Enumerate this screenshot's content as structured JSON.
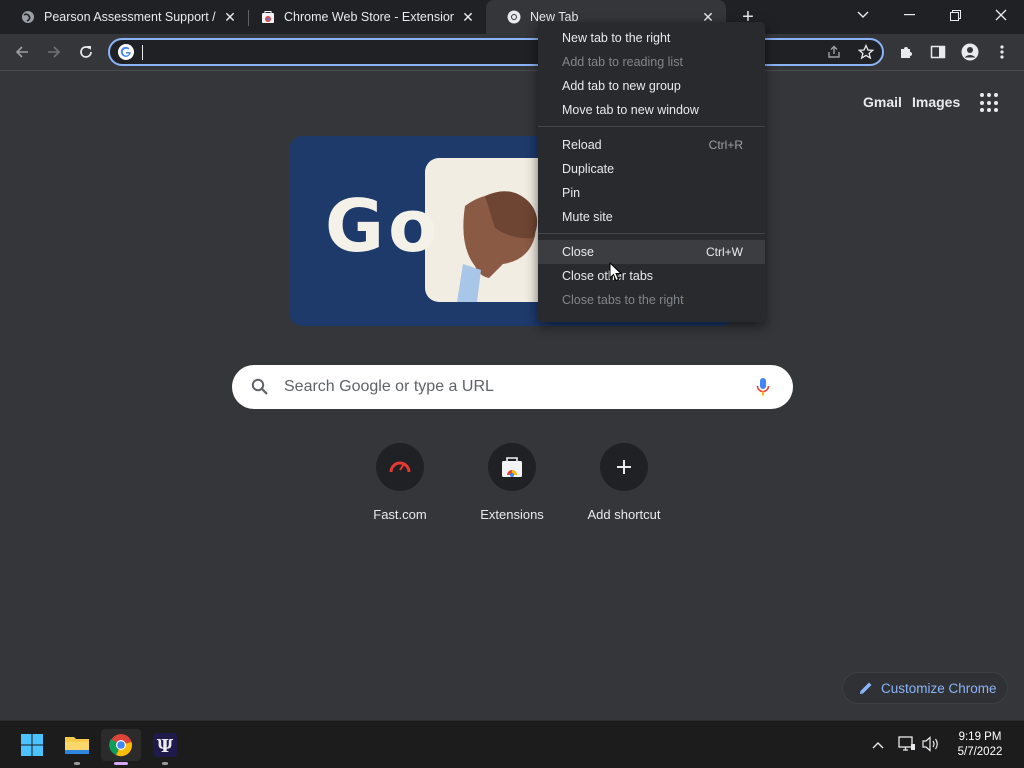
{
  "tabs": [
    {
      "title": "Pearson Assessment Support / D",
      "icon": "globe-icon"
    },
    {
      "title": "Chrome Web Store - Extensions",
      "icon": "chrome-web-store-icon"
    },
    {
      "title": "New Tab",
      "icon": "chrome-icon",
      "active": true
    }
  ],
  "omnibox": {
    "value": "",
    "placeholder": ""
  },
  "ntp": {
    "top_links": {
      "gmail": "Gmail",
      "images": "Images"
    },
    "search_placeholder": "Search Google or type a URL",
    "shortcuts": [
      {
        "label": "Fast.com",
        "icon": "speedometer-icon"
      },
      {
        "label": "Extensions",
        "icon": "chrome-web-store-icon"
      },
      {
        "label": "Add shortcut",
        "icon": "plus-icon"
      }
    ],
    "customize_label": "Customize Chrome",
    "doodle_text": "Go"
  },
  "context_menu": {
    "groups": [
      [
        {
          "label": "New tab to the right",
          "enabled": true
        },
        {
          "label": "Add tab to reading list",
          "enabled": false
        },
        {
          "label": "Add tab to new group",
          "enabled": true
        },
        {
          "label": "Move tab to new window",
          "enabled": true
        }
      ],
      [
        {
          "label": "Reload",
          "shortcut": "Ctrl+R",
          "enabled": true
        },
        {
          "label": "Duplicate",
          "enabled": true
        },
        {
          "label": "Pin",
          "enabled": true
        },
        {
          "label": "Mute site",
          "enabled": true
        }
      ],
      [
        {
          "label": "Close",
          "shortcut": "Ctrl+W",
          "enabled": true,
          "hovered": true
        },
        {
          "label": "Close other tabs",
          "enabled": true
        },
        {
          "label": "Close tabs to the right",
          "enabled": false
        }
      ]
    ]
  },
  "taskbar": {
    "apps": [
      "windows-start-icon",
      "file-explorer-icon",
      "chrome-icon",
      "psi-app-icon"
    ],
    "clock": {
      "time": "9:19 PM",
      "date": "5/7/2022"
    }
  },
  "colors": {
    "accent": "#8ab4f8",
    "background": "#35363a",
    "tabstrip": "#202124",
    "menu": "#292a2d"
  }
}
